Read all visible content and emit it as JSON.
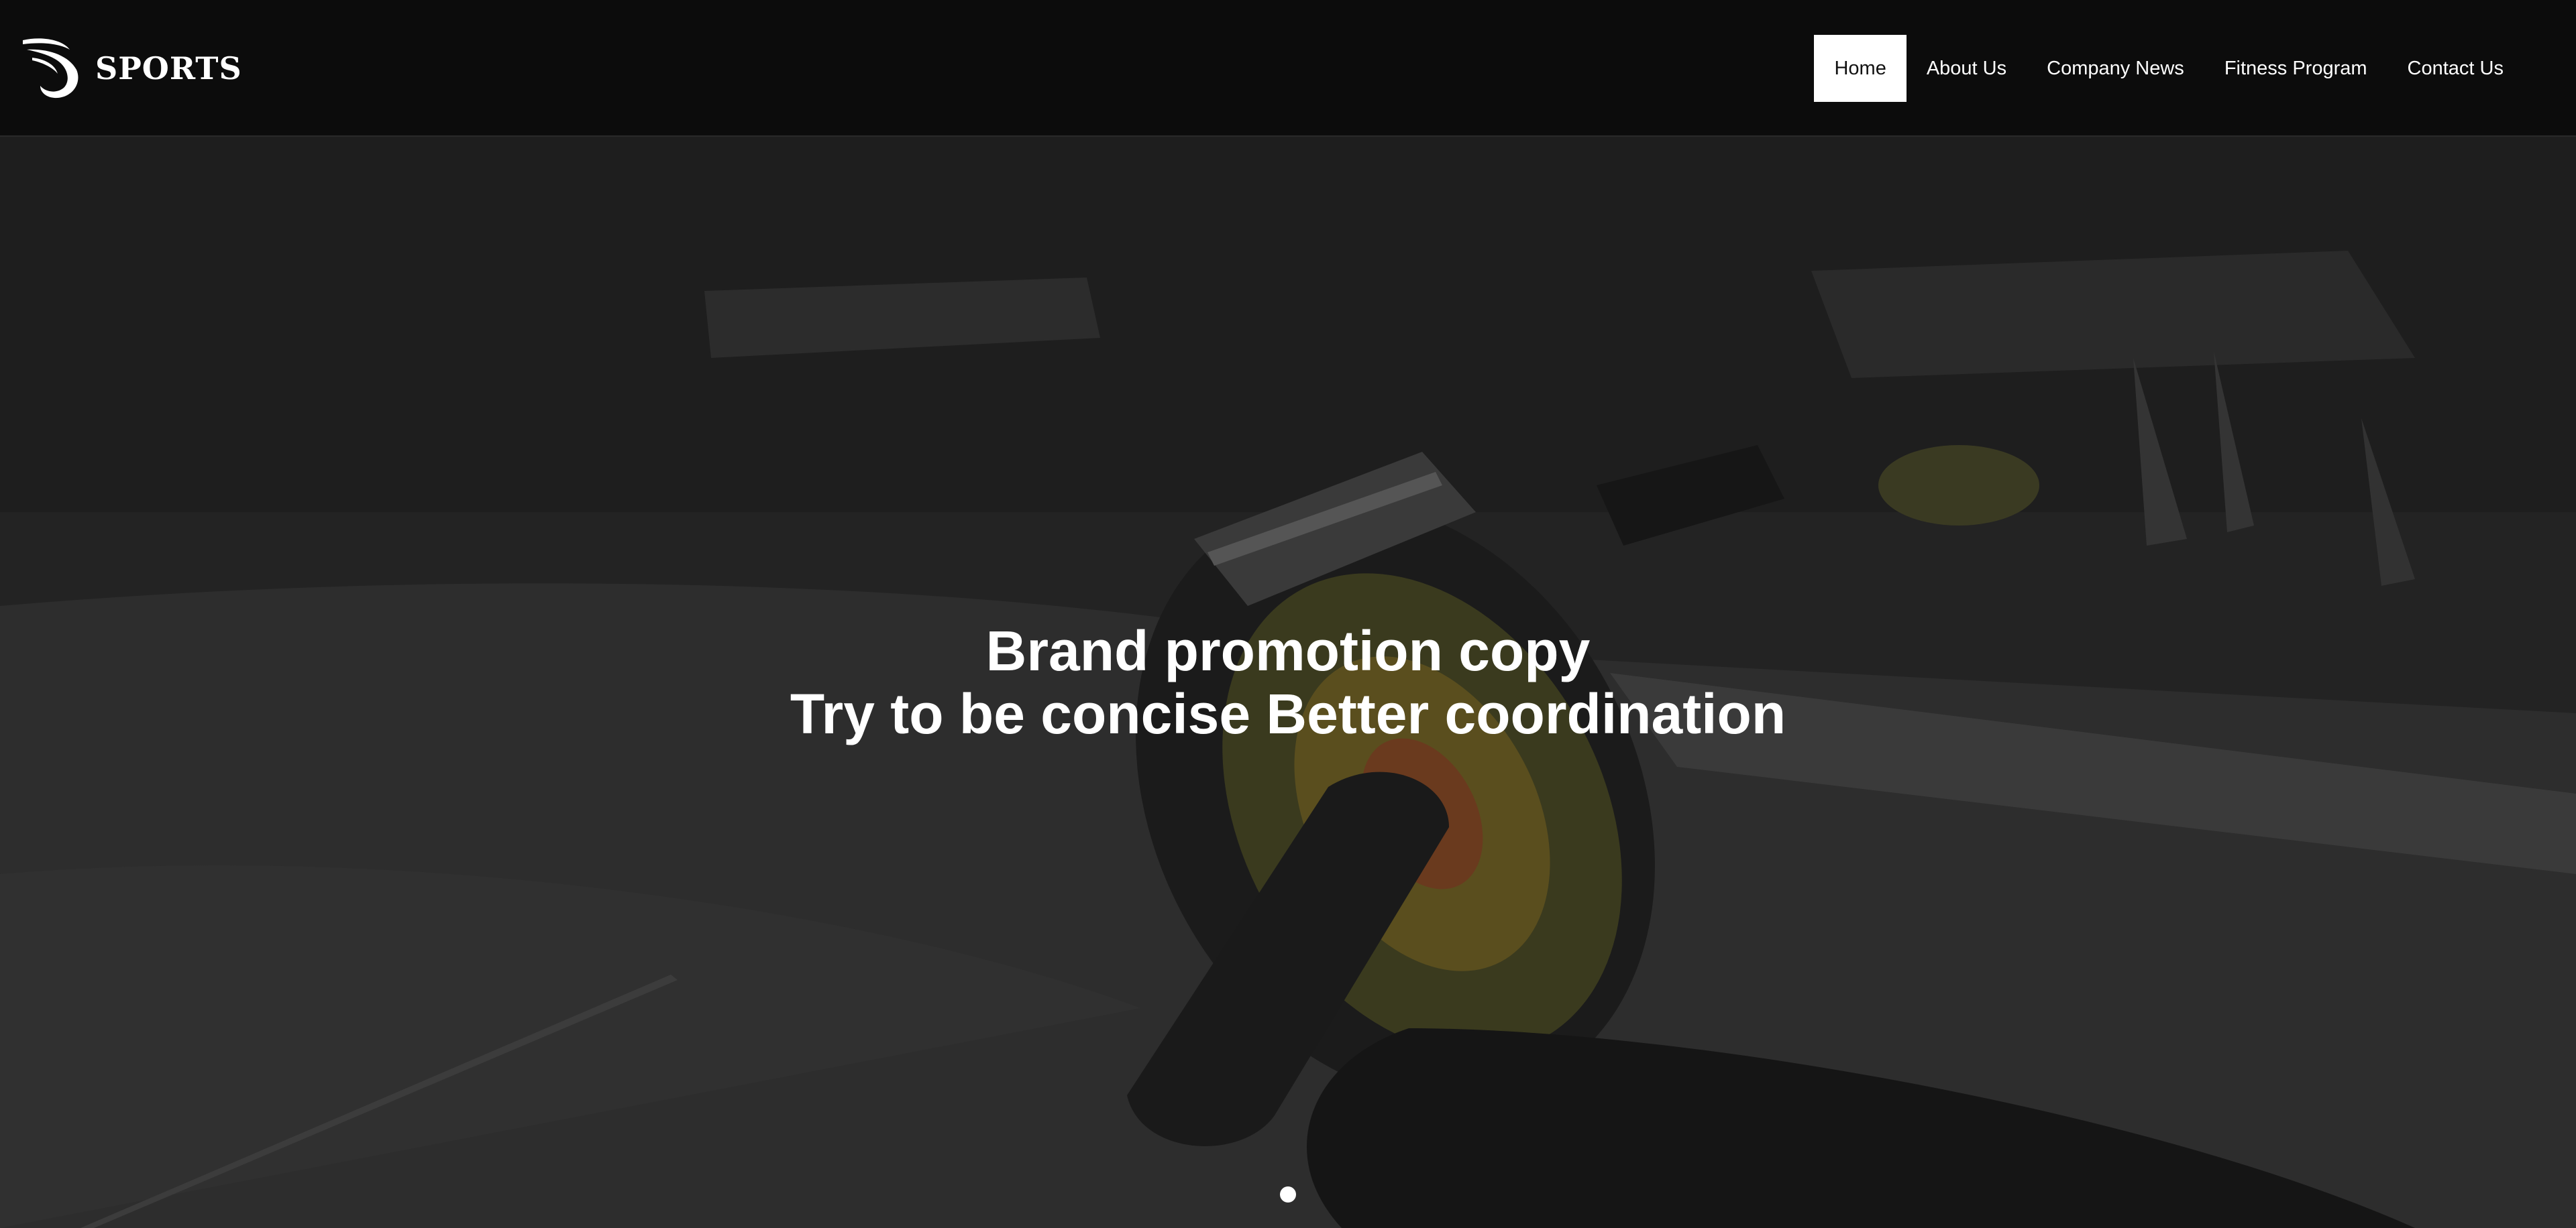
{
  "brand": {
    "logo_icon": "swoosh-logo-icon",
    "name": "SPORTS"
  },
  "nav": {
    "items": [
      {
        "label": "Home",
        "active": true
      },
      {
        "label": "About Us",
        "active": false
      },
      {
        "label": "Company News",
        "active": false
      },
      {
        "label": "Fitness Program",
        "active": false
      },
      {
        "label": "Contact Us",
        "active": false
      }
    ]
  },
  "hero": {
    "line1": "Brand promotion copy",
    "line2": "Try to be concise Better coordination",
    "image_subject": "ab-roller-wheel-on-gym-floor",
    "slide_count": 1,
    "active_slide": 1
  },
  "colors": {
    "header_bg": "#0c0c0c",
    "hero_overlay": "#262626",
    "active_nav_bg": "#ffffff",
    "text": "#ffffff",
    "wheel_accent": "#8a7a2a"
  }
}
